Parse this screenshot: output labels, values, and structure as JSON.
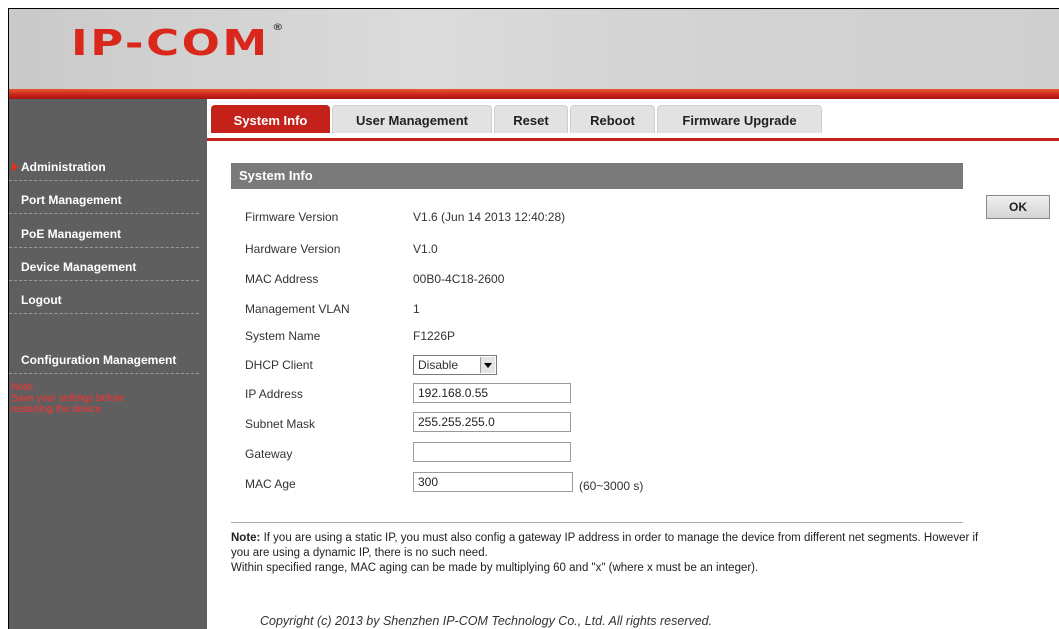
{
  "header": {
    "logo_text": "IP-COM",
    "logo_mark": "®"
  },
  "sidebar": {
    "items": [
      {
        "label": "Administration"
      },
      {
        "label": "Port Management"
      },
      {
        "label": "PoE Management"
      },
      {
        "label": "Device Management"
      },
      {
        "label": "Logout"
      },
      {
        "label": "Configuration Management"
      }
    ],
    "note_title": "Note:",
    "note_line1": "Save your settings before",
    "note_line2": "restarting the device."
  },
  "tabs": [
    {
      "label": "System Info",
      "active": true
    },
    {
      "label": "User Management"
    },
    {
      "label": "Reset"
    },
    {
      "label": "Reboot"
    },
    {
      "label": "Firmware Upgrade"
    }
  ],
  "section": {
    "title": "System Info",
    "firmware_label": "Firmware Version",
    "firmware_value": "V1.6 (Jun 14 2013 12:40:28)",
    "hardware_label": "Hardware Version",
    "hardware_value": "V1.0",
    "mac_label": "MAC Address",
    "mac_value": "00B0-4C18-2600",
    "vlan_label": "Management VLAN",
    "vlan_value": "1",
    "sysname_label": "System Name",
    "sysname_value": "F1226P",
    "dhcp_label": "DHCP Client",
    "dhcp_value": "Disable",
    "ip_label": "IP Address",
    "ip_value": "192.168.0.55",
    "mask_label": "Subnet Mask",
    "mask_value": "255.255.255.0",
    "gateway_label": "Gateway",
    "gateway_value": "",
    "macage_label": "MAC Age",
    "macage_value": "300",
    "macage_hint": "(60~3000 s)"
  },
  "ok_button": "OK",
  "note": {
    "bold": "Note:",
    "text1": " If you are using a static IP, you must also config a gateway IP address in order to manage the device from different net segments. However if you are using a dynamic IP, there is no such need.",
    "text2": "Within specified range, MAC aging can be made by multiplying 60 and \"x\" (where x must be an integer)."
  },
  "copyright": "Copyright (c) 2013 by Shenzhen IP-COM Technology Co., Ltd. All rights reserved.",
  "colors": {
    "accent": "#c3211a",
    "sidebar": "#5f5f5f",
    "section_header": "#7a7a7a"
  }
}
